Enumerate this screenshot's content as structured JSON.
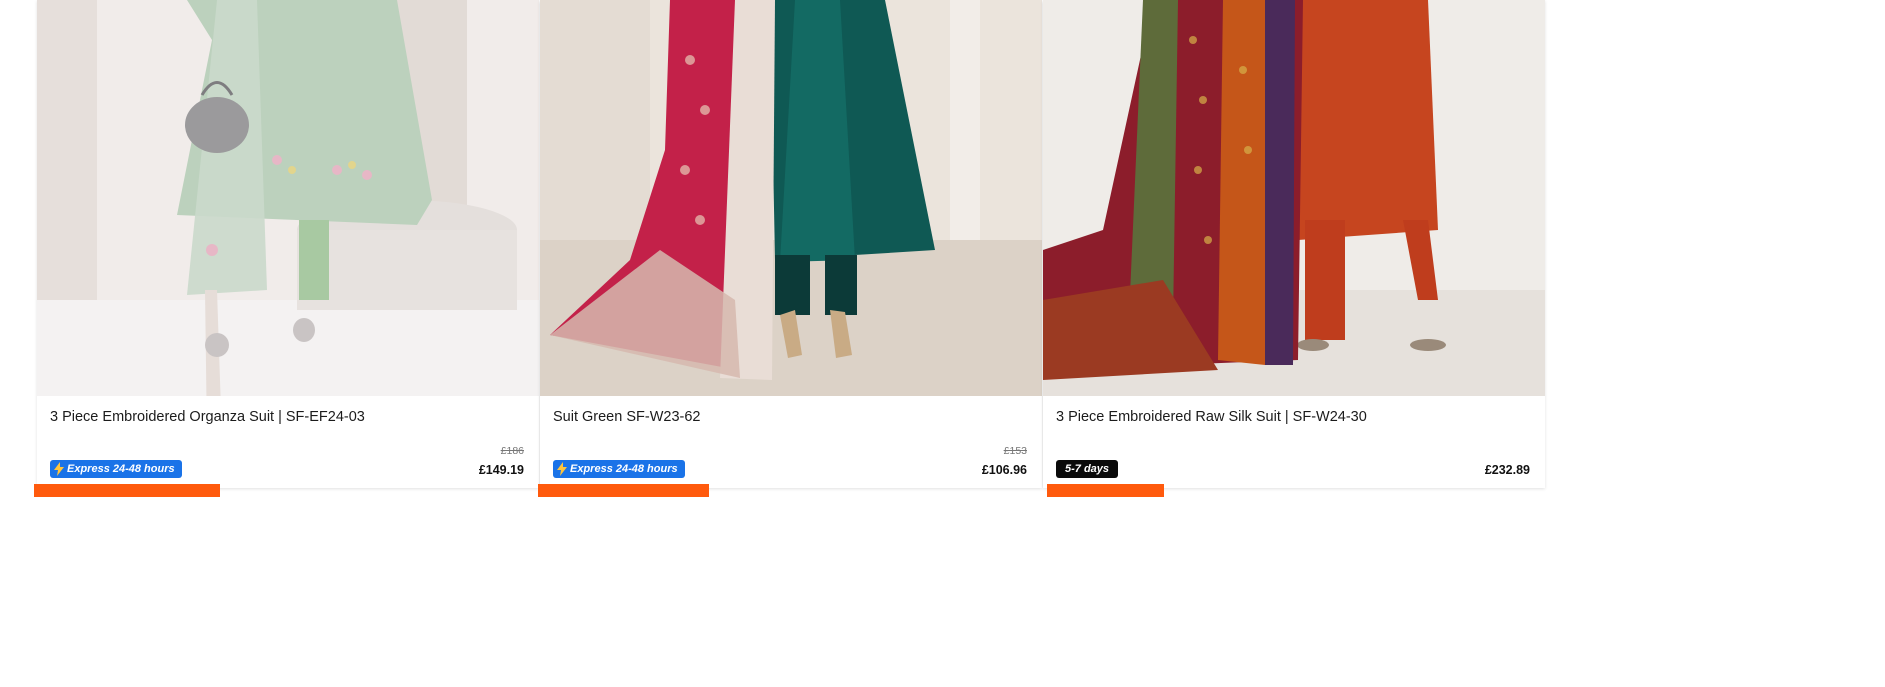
{
  "products": [
    {
      "title": "3 Piece Embroidered Organza Suit | SF-EF24-03",
      "old_price": "£186",
      "price": "£149.19",
      "badge": "Express 24-48 hours",
      "badge_type": "express",
      "image_colors": {
        "bg": "#efe9e6",
        "dress": "#b9ccb6"
      }
    },
    {
      "title": "Suit Green SF-W23-62",
      "old_price": "£153",
      "price": "£106.96",
      "badge": "Express 24-48 hours",
      "badge_type": "express",
      "image_colors": {
        "bg": "#e9e1d8",
        "dress": "#0f5a55"
      }
    },
    {
      "title": "3 Piece Embroidered Raw Silk Suit | SF-W24-30",
      "old_price": "",
      "price": "£232.89",
      "badge": "5-7 days",
      "badge_type": "days",
      "image_colors": {
        "bg": "#efece8",
        "dress": "#c4441f"
      }
    }
  ],
  "colors": {
    "express_badge": "#1a73e8",
    "days_badge": "#0a0a0a",
    "accent_bar": "#ff5a0d"
  },
  "icons": {
    "express": "lightning-bolt-icon"
  }
}
